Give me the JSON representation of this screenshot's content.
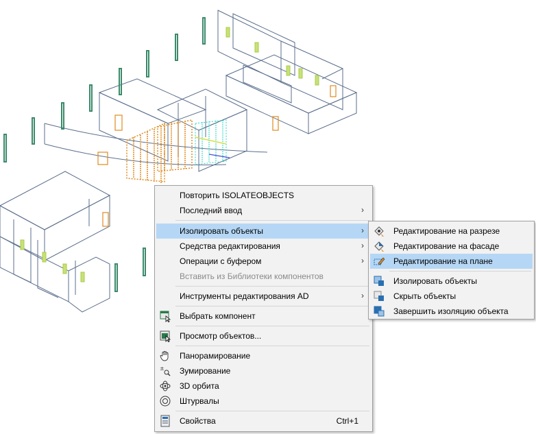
{
  "context_menu": {
    "items": [
      {
        "label": "Повторить ISOLATEOBJECTS"
      },
      {
        "label": "Последний ввод",
        "submenu": true
      },
      {
        "label": "Изолировать объекты",
        "submenu": true,
        "highlighted": true
      },
      {
        "label": "Средства редактирования",
        "submenu": true
      },
      {
        "label": "Операции с буфером",
        "submenu": true
      },
      {
        "label": "Вставить из Библиотеки компонентов",
        "disabled": true
      },
      {
        "label": "Инструменты редактирования AD",
        "submenu": true
      },
      {
        "label": "Выбрать компонент",
        "icon": "select-component-icon"
      },
      {
        "label": "Просмотр объектов...",
        "icon": "object-viewer-icon"
      },
      {
        "label": "Панорамирование",
        "icon": "pan-hand-icon"
      },
      {
        "label": "Зумирование",
        "icon": "zoom-icon"
      },
      {
        "label": "3D орбита",
        "icon": "orbit-3d-icon"
      },
      {
        "label": "Штурвалы",
        "icon": "steering-wheel-icon"
      },
      {
        "label": "Свойства",
        "icon": "properties-icon",
        "shortcut": "Ctrl+1"
      }
    ]
  },
  "submenu": {
    "items": [
      {
        "label": "Редактирование на разрезе",
        "icon": "edit-in-section-icon"
      },
      {
        "label": "Редактирование на фасаде",
        "icon": "edit-in-elevation-icon"
      },
      {
        "label": "Редактирование на плане",
        "icon": "edit-in-plan-icon",
        "highlighted": true
      },
      {
        "label": "Изолировать объекты",
        "icon": "isolate-objects-icon"
      },
      {
        "label": "Скрыть объекты",
        "icon": "hide-objects-icon"
      },
      {
        "label": "Завершить изоляцию объекта",
        "icon": "end-isolation-icon"
      }
    ]
  },
  "arrow_glyph": "›",
  "colors": {
    "highlight": "#b5d7f5",
    "menu_bg": "#f2f2f2",
    "wall_stroke": "#5a6e8c",
    "door_orange": "#e08a1e",
    "window_green": "#a8cc44",
    "column_green": "#3a8a6a",
    "hatch_cyan": "#22d4c0"
  }
}
